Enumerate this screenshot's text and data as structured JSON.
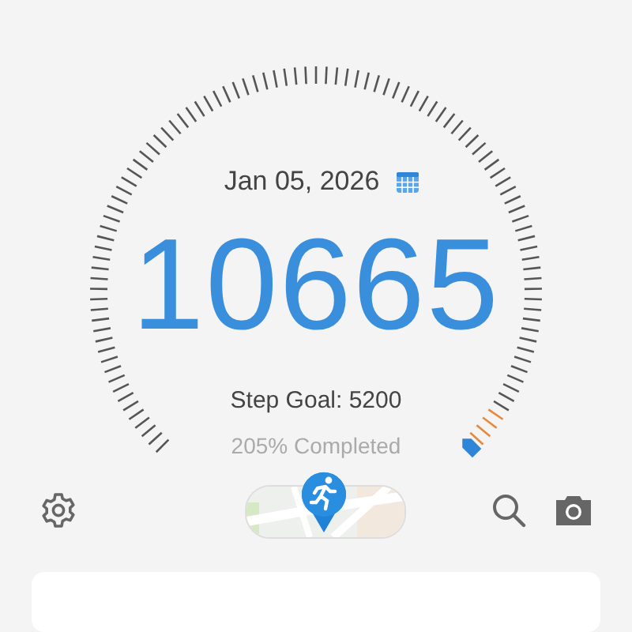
{
  "date": "Jan 05, 2026",
  "steps": "10665",
  "goal": "Step Goal: 5200",
  "completed": "205% Completed",
  "toolbar": [
    {
      "kind": "settings"
    },
    {
      "kind": "map"
    },
    {
      "kind": "search"
    },
    {
      "kind": "camera"
    }
  ]
}
